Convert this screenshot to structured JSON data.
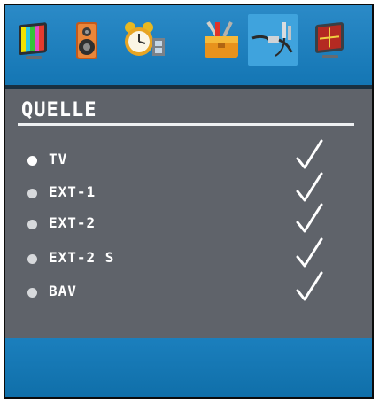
{
  "toolbar": {
    "icons": [
      {
        "name": "picture-icon",
        "selected": false
      },
      {
        "name": "sound-icon",
        "selected": false
      },
      {
        "name": "clock-icon",
        "selected": false
      },
      {
        "name": "toolbox-icon",
        "selected": false
      },
      {
        "name": "source-cables-icon",
        "selected": true
      },
      {
        "name": "pc-monitor-icon",
        "selected": false
      }
    ]
  },
  "panel": {
    "title": "QUELLE"
  },
  "sources": [
    {
      "label": "TV",
      "enabled": true,
      "selected": true
    },
    {
      "label": "EXT-1",
      "enabled": true,
      "selected": false
    },
    {
      "label": "EXT-2",
      "enabled": true,
      "selected": false
    },
    {
      "label": "EXT-2 S",
      "enabled": true,
      "selected": false
    },
    {
      "label": "BAV",
      "enabled": true,
      "selected": false
    }
  ],
  "colors": {
    "menu_blue": "#1476b4",
    "panel_gray": "#5f636a",
    "text": "#ffffff"
  }
}
